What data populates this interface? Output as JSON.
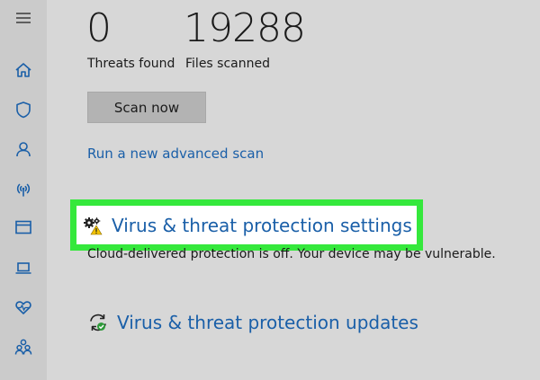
{
  "stats": [
    {
      "value": "0",
      "label": "Threats found"
    },
    {
      "value": "19288",
      "label": "Files scanned"
    }
  ],
  "scan": {
    "button_label": "Scan now",
    "advanced_link": "Run a new advanced scan"
  },
  "settings_section": {
    "title": "Virus & threat protection settings",
    "icon": "settings-warning-icon",
    "status": "Cloud-delivered protection is off. Your device may be vulnerable."
  },
  "updates_section": {
    "title": "Virus & threat protection updates",
    "icon": "refresh-check-icon"
  },
  "sidebar": {
    "items": [
      {
        "icon": "menu-icon"
      },
      {
        "icon": "home-icon"
      },
      {
        "icon": "shield-icon"
      },
      {
        "icon": "account-icon"
      },
      {
        "icon": "wireless-icon"
      },
      {
        "icon": "browser-icon"
      },
      {
        "icon": "laptop-icon"
      },
      {
        "icon": "heart-icon"
      },
      {
        "icon": "family-icon"
      }
    ]
  },
  "colors": {
    "link": "#1a5fa8",
    "highlight": "#35e83c",
    "icon": "#1a5fa8",
    "background": "#d7d7d7"
  }
}
